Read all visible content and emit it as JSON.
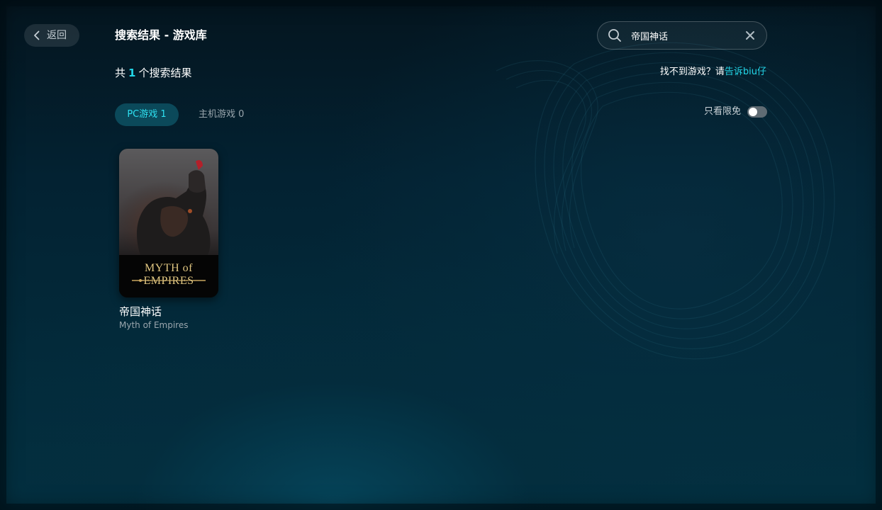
{
  "header": {
    "back_label": "返回",
    "page_title": "搜索结果 - 游戏库"
  },
  "search": {
    "value": "帝国神话"
  },
  "results": {
    "prefix": "共",
    "count": "1",
    "suffix": "个搜索结果"
  },
  "not_found": {
    "text": "找不到游戏？请",
    "link": "告诉biu仔"
  },
  "tabs": [
    {
      "label": "PC游戏 1",
      "active": true
    },
    {
      "label": "主机游戏 0",
      "active": false
    }
  ],
  "filter": {
    "free_only_label": "只看限免",
    "free_only_on": false
  },
  "games": [
    {
      "title": "帝国神话",
      "subtitle": "Myth of Empires",
      "cover_logo": "MYTH of EMPIRES"
    }
  ],
  "colors": {
    "accent": "#22d6e8",
    "background": "#032232"
  },
  "icons": {
    "back": "chevron-left-icon",
    "search": "search-icon",
    "clear": "clear-icon"
  }
}
